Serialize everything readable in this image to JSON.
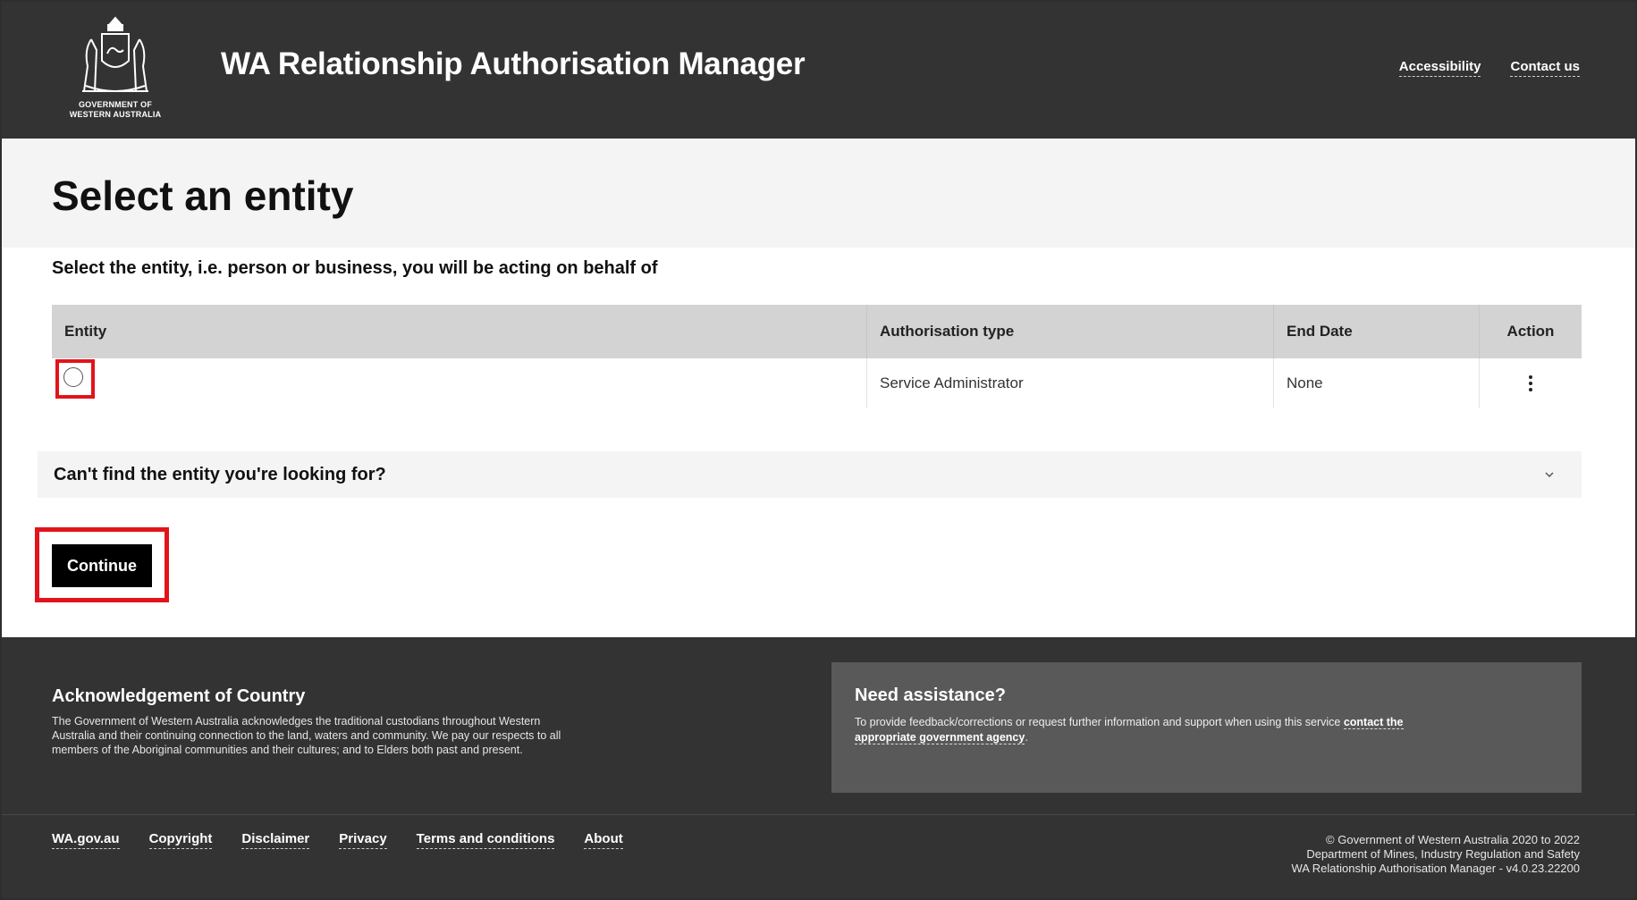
{
  "header": {
    "logo_text_line1": "GOVERNMENT OF",
    "logo_text_line2": "WESTERN AUSTRALIA",
    "app_title": "WA Relationship Authorisation Manager",
    "links": {
      "accessibility": "Accessibility",
      "contact": "Contact us"
    }
  },
  "page": {
    "title": "Select an entity",
    "instruction": "Select the entity, i.e. person or business, you will be acting on behalf of"
  },
  "table": {
    "headers": {
      "entity": "Entity",
      "auth_type": "Authorisation type",
      "end_date": "End Date",
      "action": "Action"
    },
    "rows": [
      {
        "entity": "",
        "auth_type": "Service Administrator",
        "end_date": "None"
      }
    ]
  },
  "accordion": {
    "label": "Can't find the entity you're looking for?"
  },
  "continue_label": "Continue",
  "footer": {
    "ack_title": "Acknowledgement of Country",
    "ack_line1": "The Government of Western Australia acknowledges the traditional custodians throughout Western",
    "ack_line2": "Australia and their continuing connection to the land, waters and community. We pay our respects to all",
    "ack_line3": "members of the Aboriginal communities and their cultures; and to Elders both past and present.",
    "assist_title": "Need assistance?",
    "assist_text": "To provide feedback/corrections or request further information and support when using this service",
    "assist_link_1": "contact the",
    "assist_link_2": "appropriate government agency",
    "assist_end": ".",
    "links": {
      "wa": "WA.gov.au",
      "copyright": "Copyright",
      "disclaimer": "Disclaimer",
      "privacy": "Privacy",
      "terms": "Terms and conditions",
      "about": "About"
    },
    "copyright_line1": "© Government of Western Australia 2020 to 2022",
    "copyright_line2": "Department of Mines, Industry Regulation and Safety",
    "copyright_line3": "WA Relationship Authorisation Manager - v4.0.23.22200"
  },
  "colors": {
    "header_bg": "#333333",
    "highlight": "#e1141b",
    "button_bg": "#000000"
  }
}
